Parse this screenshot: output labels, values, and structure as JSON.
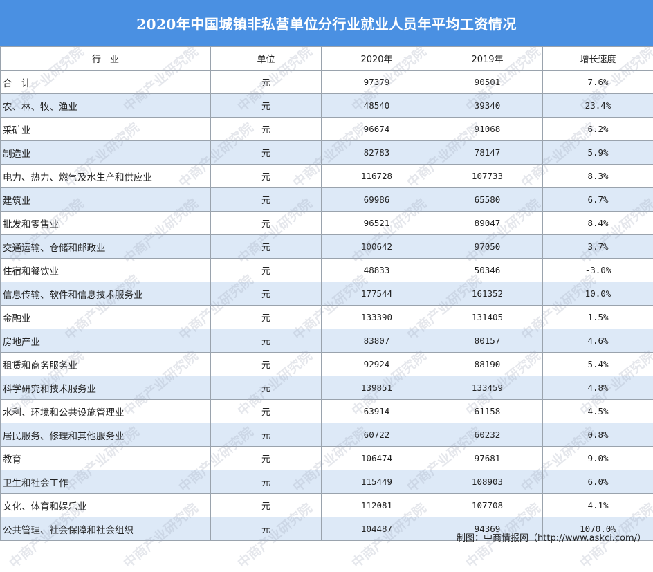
{
  "title": "2020年中国城镇非私营单位分行业就业人员年平均工资情况",
  "headers": [
    "行　业",
    "单位",
    "2020年",
    "2019年",
    "增长速度"
  ],
  "rows": [
    [
      "合　计",
      "元",
      "97379",
      "90501",
      "7.6%"
    ],
    [
      "农、林、牧、渔业",
      "元",
      "48540",
      "39340",
      "23.4%"
    ],
    [
      "采矿业",
      "元",
      "96674",
      "91068",
      "6.2%"
    ],
    [
      "制造业",
      "元",
      "82783",
      "78147",
      "5.9%"
    ],
    [
      "电力、热力、燃气及水生产和供应业",
      "元",
      "116728",
      "107733",
      "8.3%"
    ],
    [
      "建筑业",
      "元",
      "69986",
      "65580",
      "6.7%"
    ],
    [
      "批发和零售业",
      "元",
      "96521",
      "89047",
      "8.4%"
    ],
    [
      "交通运输、仓储和邮政业",
      "元",
      "100642",
      "97050",
      "3.7%"
    ],
    [
      "住宿和餐饮业",
      "元",
      "48833",
      "50346",
      "-3.0%"
    ],
    [
      "信息传输、软件和信息技术服务业",
      "元",
      "177544",
      "161352",
      "10.0%"
    ],
    [
      "金融业",
      "元",
      "133390",
      "131405",
      "1.5%"
    ],
    [
      "房地产业",
      "元",
      "83807",
      "80157",
      "4.6%"
    ],
    [
      "租赁和商务服务业",
      "元",
      "92924",
      "88190",
      "5.4%"
    ],
    [
      "科学研究和技术服务业",
      "元",
      "139851",
      "133459",
      "4.8%"
    ],
    [
      "水利、环境和公共设施管理业",
      "元",
      "63914",
      "61158",
      "4.5%"
    ],
    [
      "居民服务、修理和其他服务业",
      "元",
      "60722",
      "60232",
      "0.8%"
    ],
    [
      "教育",
      "元",
      "106474",
      "97681",
      "9.0%"
    ],
    [
      "卫生和社会工作",
      "元",
      "115449",
      "108903",
      "6.0%"
    ],
    [
      "文化、体育和娱乐业",
      "元",
      "112081",
      "107708",
      "4.1%"
    ],
    [
      "公共管理、社会保障和社会组织",
      "元",
      "104487",
      "94369",
      "1070.0%"
    ]
  ],
  "footer": "制图：中商情报网（http://www.askci.com/）",
  "watermark": "中商产业研究院",
  "colors": {
    "header_bg": "#4a90e2",
    "stripe": "#dde9f7",
    "border": "#9aa3ad"
  }
}
